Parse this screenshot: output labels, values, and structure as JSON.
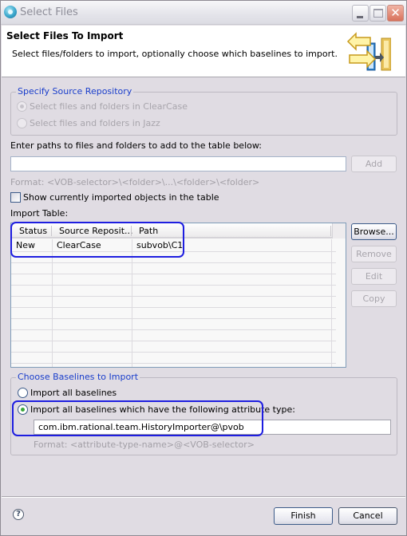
{
  "window": {
    "title": "Select Files",
    "icon": "eclipse-app-icon",
    "controls": [
      "minimize",
      "maximize",
      "close"
    ]
  },
  "header": {
    "title": "Select Files To Import",
    "description": "Select files/folders to import, optionally choose which baselines to import.",
    "icon": "import-arrows-icon"
  },
  "source_repository": {
    "legend": "Specify Source Repository",
    "options": [
      {
        "label": "Select files and folders in ClearCase",
        "checked": true,
        "enabled": false
      },
      {
        "label": "Select files and folders in Jazz",
        "checked": false,
        "enabled": false
      }
    ]
  },
  "path_entry": {
    "label": "Enter paths to files and folders to add to the table below:",
    "value": "",
    "add_label": "Add",
    "format_hint": "Format:  <VOB-selector>\\<folder>\\...\\<folder>\\<folder>"
  },
  "show_imported": {
    "label": "Show currently imported objects in the table",
    "checked": false
  },
  "import_table": {
    "label": "Import Table:",
    "columns": [
      "Status",
      "Source Reposit...",
      "Path"
    ],
    "rows": [
      {
        "status": "New",
        "source": "ClearCase",
        "path": "subvob\\C1"
      }
    ]
  },
  "table_buttons": {
    "browse": "Browse...",
    "remove": "Remove",
    "edit": "Edit",
    "copy": "Copy"
  },
  "baselines": {
    "legend": "Choose Baselines to Import",
    "options": [
      {
        "label": "Import all baselines",
        "checked": false
      },
      {
        "label": "Import all baselines which have the following attribute type:",
        "checked": true
      }
    ],
    "attribute_value": "com.ibm.rational.team.HistoryImporter@\\pvob",
    "format_hint": "Format:  <attribute-type-name>@<VOB-selector>"
  },
  "footer": {
    "help": "?",
    "finish": "Finish",
    "cancel": "Cancel"
  },
  "colors": {
    "accent": "#1a3ecb",
    "highlight": "#1e1ee0",
    "dialog_bg": "#e0dce3"
  }
}
